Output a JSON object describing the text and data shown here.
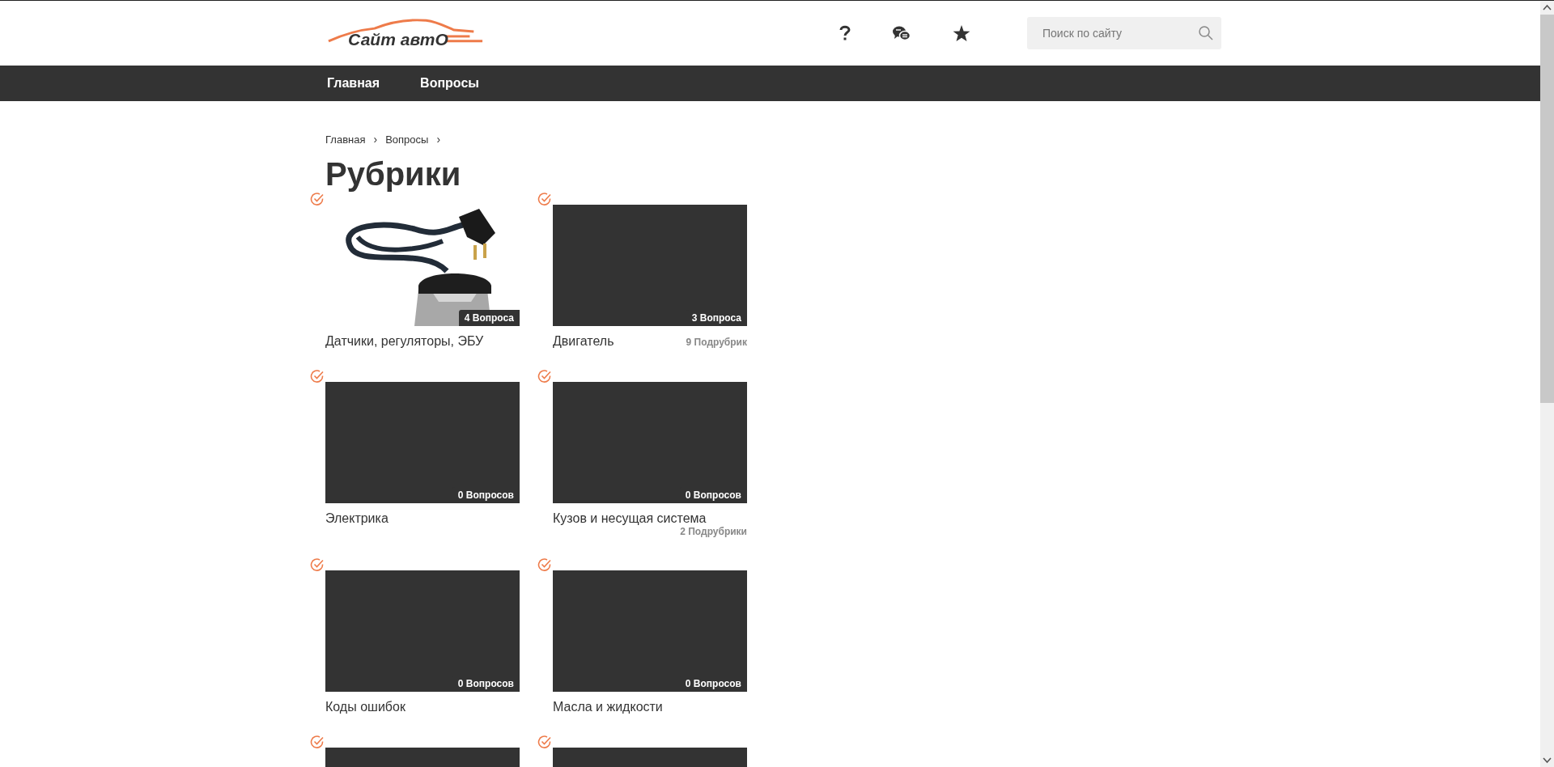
{
  "header": {
    "logo": "Сайт автО",
    "search": {
      "placeholder": "Поиск по сайту"
    }
  },
  "nav": [
    {
      "label": "Главная"
    },
    {
      "label": "Вопросы"
    }
  ],
  "breadcrumbs": [
    {
      "label": "Главная",
      "sep": "›"
    },
    {
      "label": "Вопросы",
      "sep": "›"
    }
  ],
  "title": "Рубрики",
  "categories": [
    {
      "kind": "picture",
      "count": "4 Вопроса",
      "title": "Датчики, регуляторы, ЭБУ"
    },
    {
      "kind": "empty",
      "count": "3 Вопроса",
      "title": "Двигатель",
      "subs": "9 Подрубрик"
    },
    {
      "kind": "empty",
      "count": "0 Вопросов",
      "title": "Электрика"
    },
    {
      "kind": "empty",
      "count": "0 Вопросов",
      "title": "Кузов и несущая система",
      "subs": "2 Подрубрики"
    },
    {
      "kind": "empty",
      "count": "0 Вопросов",
      "title": "Коды ошибок"
    },
    {
      "kind": "empty",
      "count": "0 Вопросов",
      "title": "Масла и жидкости"
    },
    {
      "kind": "empty"
    },
    {
      "kind": "empty"
    }
  ]
}
